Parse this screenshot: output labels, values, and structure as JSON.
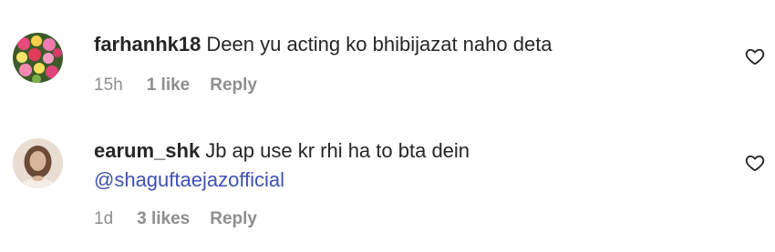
{
  "comments": [
    {
      "username": "farhanhk18",
      "text": "Deen yu acting ko bhibijazat naho deta",
      "mention": "",
      "time": "15h",
      "likes": "1 like",
      "reply_label": "Reply",
      "avatar_icon": "flower-bouquet-avatar",
      "like_icon": "heart-outline-icon"
    },
    {
      "username": "earum_shk",
      "text": "Jb ap use kr rhi ha to bta dein",
      "mention": "@shaguftaejazofficial",
      "time": "1d",
      "likes": "3 likes",
      "reply_label": "Reply",
      "avatar_icon": "profile-photo-avatar",
      "like_icon": "heart-outline-icon"
    }
  ],
  "colors": {
    "text": "#262626",
    "meta": "#8e8e8e",
    "mention": "#3f51b5"
  }
}
